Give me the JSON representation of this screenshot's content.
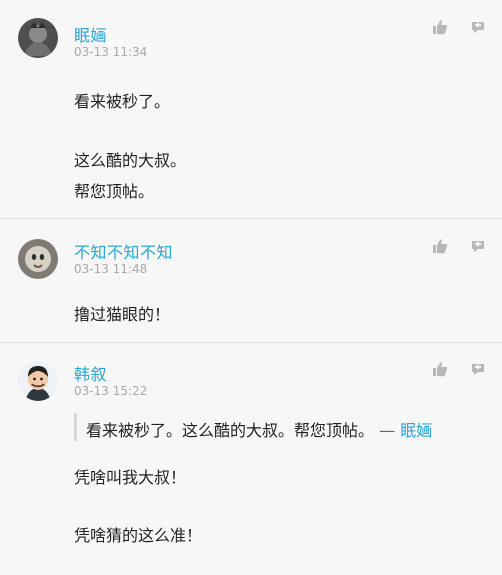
{
  "comments": [
    {
      "username": "眠婳",
      "time": "03-13 11:34",
      "lines": [
        "看来被秒了。",
        "这么酷的大叔。",
        "帮您顶帖。"
      ]
    },
    {
      "username": "不知不知不知",
      "time": "03-13 11:48",
      "lines": [
        "撸过猫眼的！"
      ]
    },
    {
      "username": "韩叙",
      "time": "03-13 15:22",
      "quote": {
        "text": "看来被秒了。这么酷的大叔。帮您顶帖。",
        "separator": "—",
        "author": "眠婳"
      },
      "lines": [
        "凭啥叫我大叔！",
        "凭啥猜的这么准！"
      ]
    }
  ],
  "icons": [
    "like-icon",
    "reply-icon"
  ]
}
